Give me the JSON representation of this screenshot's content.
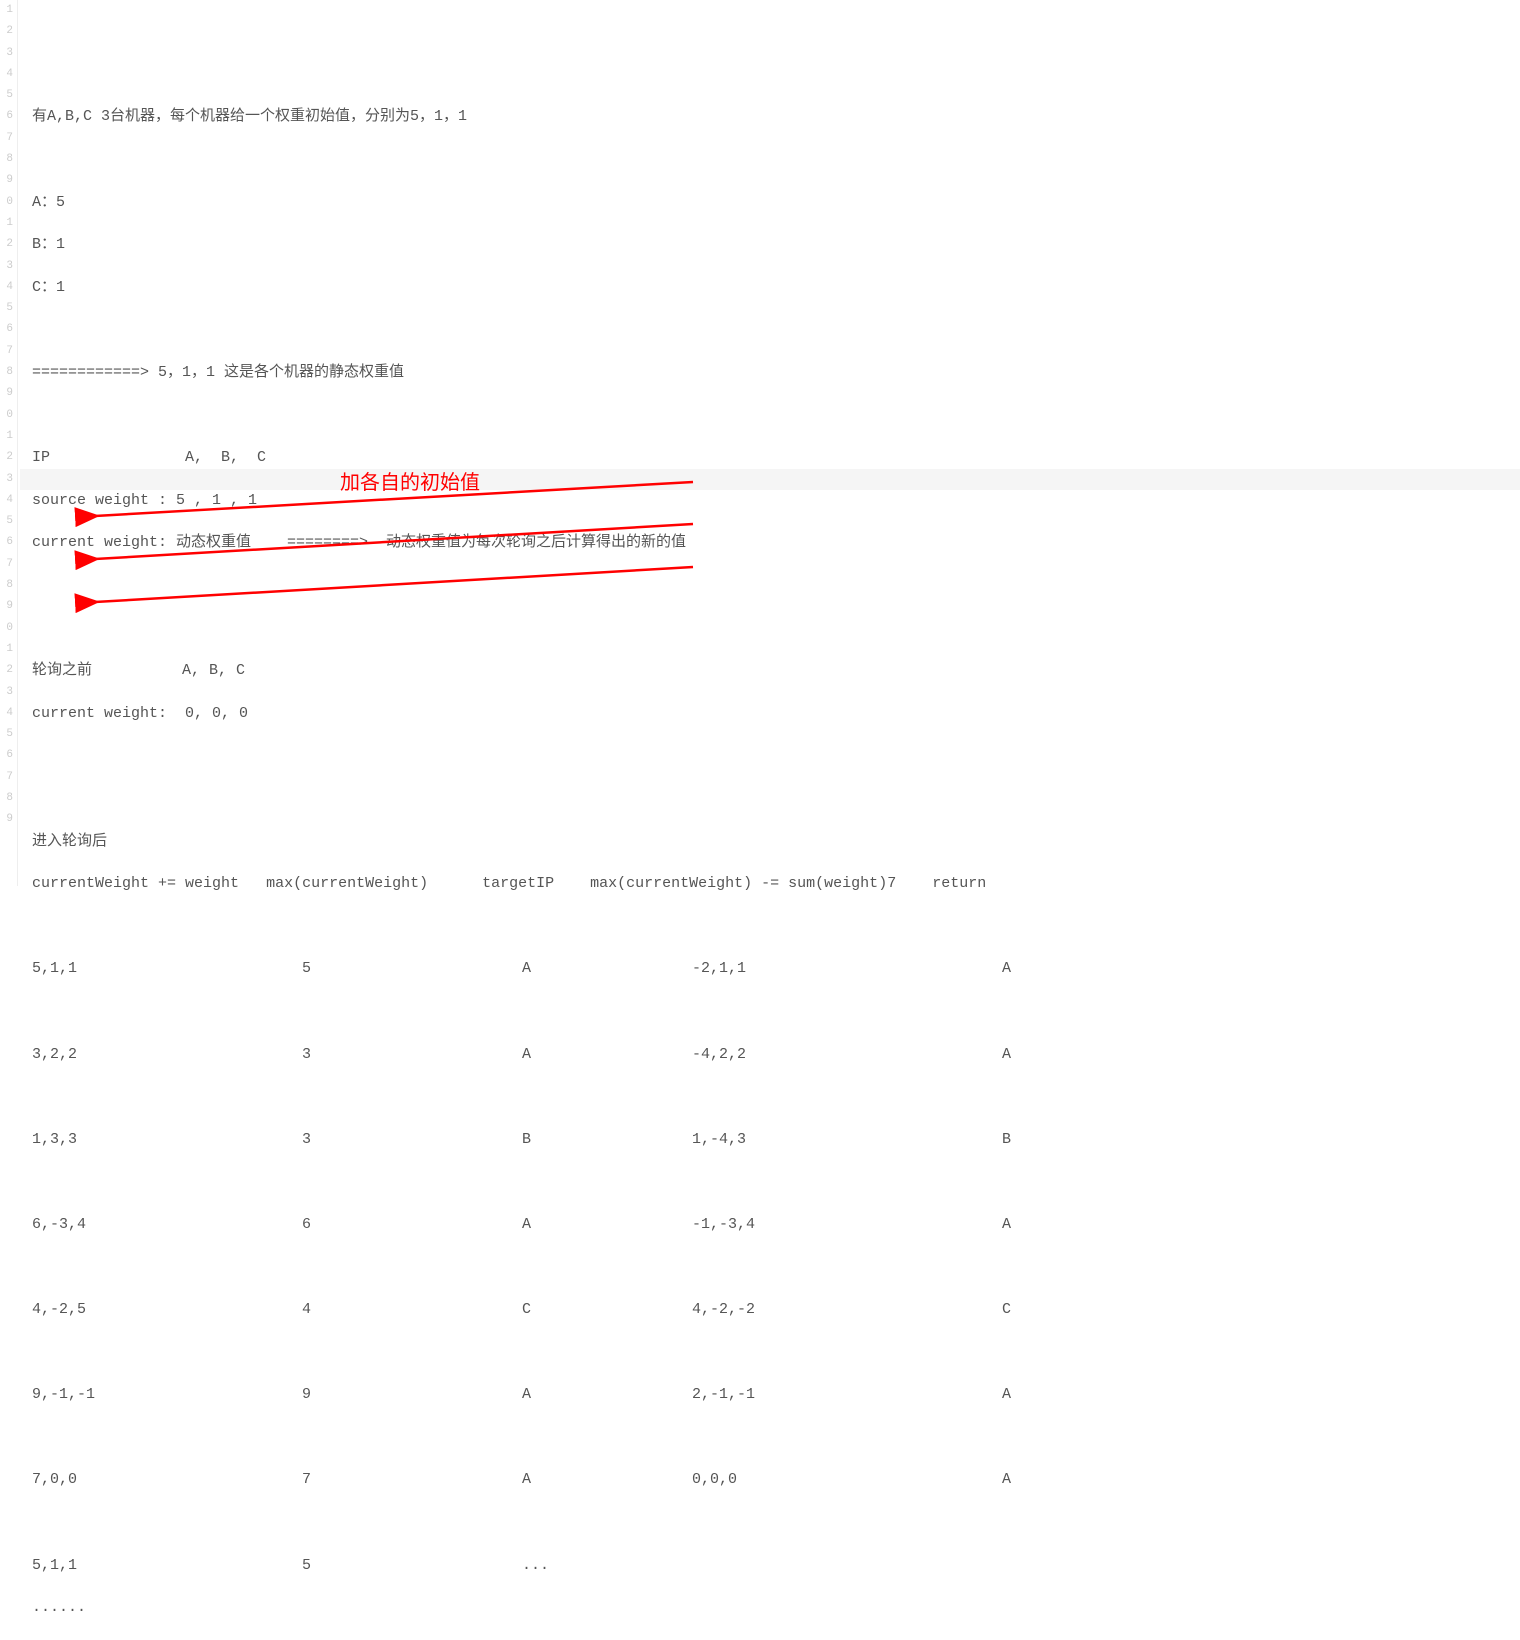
{
  "intro_line": "有A,B,C 3台机器，每个机器给一个权重初始值，分别为5，1，1",
  "machines": {
    "a": "A：5",
    "b": "B：1",
    "c": "C：1"
  },
  "static_weight_line": "============> 5，1，1 这是各个机器的静态权重值",
  "ip_header": "IP               A,  B,  C",
  "source_weight": "source weight : 5 , 1 , 1",
  "current_weight_desc": "current weight: 动态权重值    ========>  动态权重值为每次轮询之后计算得出的新的值",
  "before_poll_label": "轮询之前          A, B, C",
  "before_poll_values": "current weight:  0, 0, 0",
  "after_poll_label": "进入轮询后",
  "table_header": {
    "col1": "currentWeight += weight",
    "col2": "max(currentWeight)",
    "col3": "targetIP",
    "col4": "max(currentWeight) -= sum(weight)7",
    "col5": "return"
  },
  "rows": [
    {
      "c1": "5,1,1",
      "c2": "5",
      "c3": "A",
      "c4": "-2,1,1",
      "c5": "A"
    },
    {
      "c1": "3,2,2",
      "c2": "3",
      "c3": "A",
      "c4": "-4,2,2",
      "c5": "A"
    },
    {
      "c1": "1,3,3",
      "c2": "3",
      "c3": "B",
      "c4": "1,-4,3",
      "c5": "B"
    },
    {
      "c1": "6,-3,4",
      "c2": "6",
      "c3": "A",
      "c4": "-1,-3,4",
      "c5": "A"
    },
    {
      "c1": "4,-2,5",
      "c2": "4",
      "c3": "C",
      "c4": "4,-2,-2",
      "c5": "C"
    },
    {
      "c1": "9,-1,-1",
      "c2": "9",
      "c3": "A",
      "c4": "2,-1,-1",
      "c5": "A"
    },
    {
      "c1": "7,0,0",
      "c2": "7",
      "c3": "A",
      "c4": "0,0,0",
      "c5": "A"
    },
    {
      "c1": "5,1,1",
      "c2": "5",
      "c3": "...",
      "c4": "",
      "c5": ""
    }
  ],
  "ellipsis": "......",
  "annotation": "加各自的初始值",
  "gutter_labels": [
    "1",
    "2",
    "3",
    "4",
    "5",
    "6",
    "7",
    "8",
    "9",
    "0",
    "1",
    "2",
    "3",
    "4",
    "5",
    "6",
    "7",
    "8",
    "9",
    "0",
    "1",
    "2",
    "3",
    "4",
    "5",
    "6",
    "7",
    "8",
    "9",
    "0",
    "1",
    "2",
    "3",
    "4",
    "5",
    "6",
    "7",
    "8",
    "9"
  ]
}
